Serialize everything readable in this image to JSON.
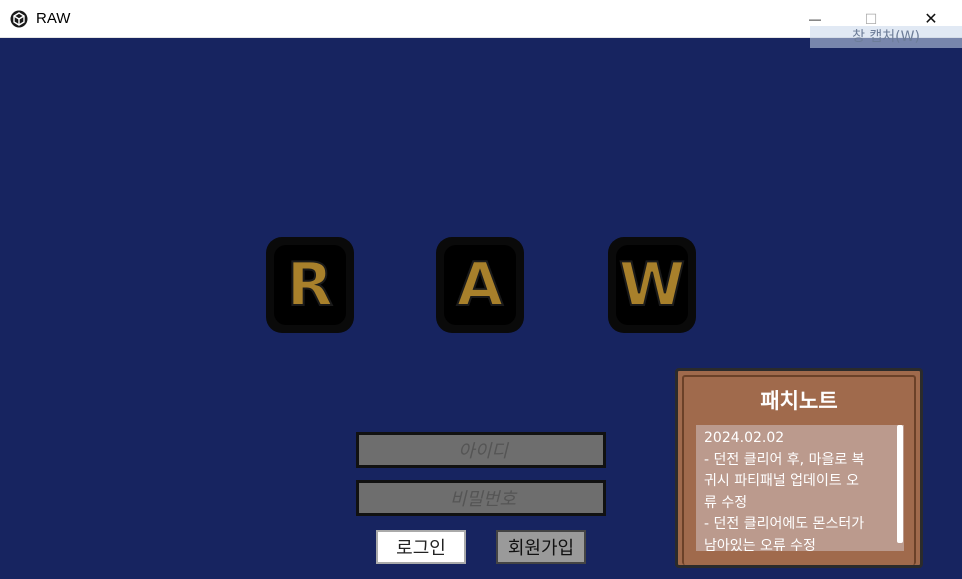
{
  "window": {
    "title": "RAW",
    "minimize_label": "—",
    "maximize_label": "☐",
    "close_label": "✕",
    "capture_tooltip": "창 캡처(W)"
  },
  "logo": {
    "letters": [
      "R",
      "A",
      "W"
    ]
  },
  "login": {
    "id_placeholder": "아이디",
    "pw_placeholder": "비밀번호",
    "login_button": "로그인",
    "signup_button": "회원가입"
  },
  "patch_notes": {
    "title": "패치노트",
    "lines": [
      "2024.02.02",
      "- 던전 클리어 후, 마을로 복",
      "귀시 파티패널 업데이트 오",
      "류 수정",
      "- 던전 클리어에도 몬스터가",
      "남아있는 오류 수정"
    ]
  },
  "colors": {
    "background": "#172460",
    "logo_gold": "#a8802b",
    "panel_brown": "#a06a4c",
    "field_gray": "#6e6e6e"
  }
}
